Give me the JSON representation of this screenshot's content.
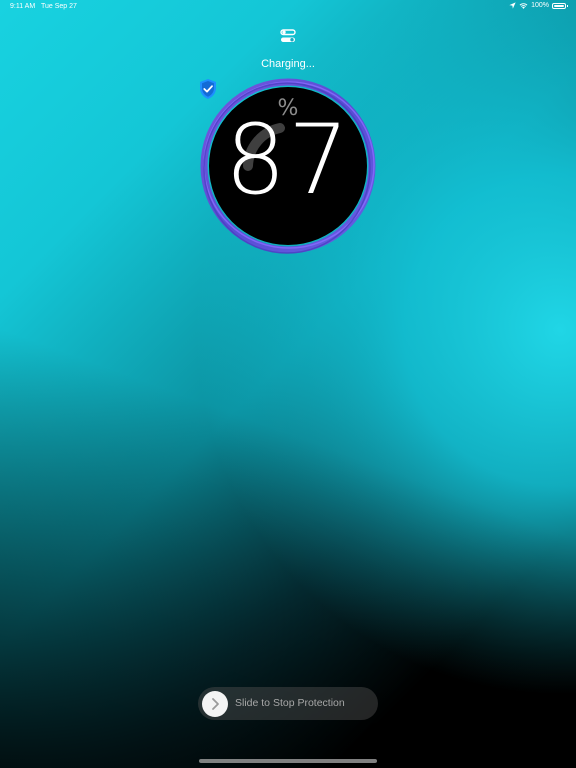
{
  "status_bar": {
    "time": "9:11 AM",
    "date": "Tue Sep 27",
    "battery_percent": "100%",
    "icons": [
      "location-arrow-icon",
      "wifi-icon",
      "battery-full-icon"
    ]
  },
  "header": {
    "settings_icon": "settings-toggle-icon",
    "status_text": "Charging..."
  },
  "dial": {
    "value": "87",
    "unit": "%",
    "badge_icon": "shield-check-icon"
  },
  "slider": {
    "label": "Slide to Stop Protection",
    "knob_icon": "chevron-right-icon"
  },
  "colors": {
    "background_accent": "#18d2e0",
    "ring": "#6a4fd8",
    "dial_fill": "#000000",
    "shield": "#1e90ff"
  }
}
